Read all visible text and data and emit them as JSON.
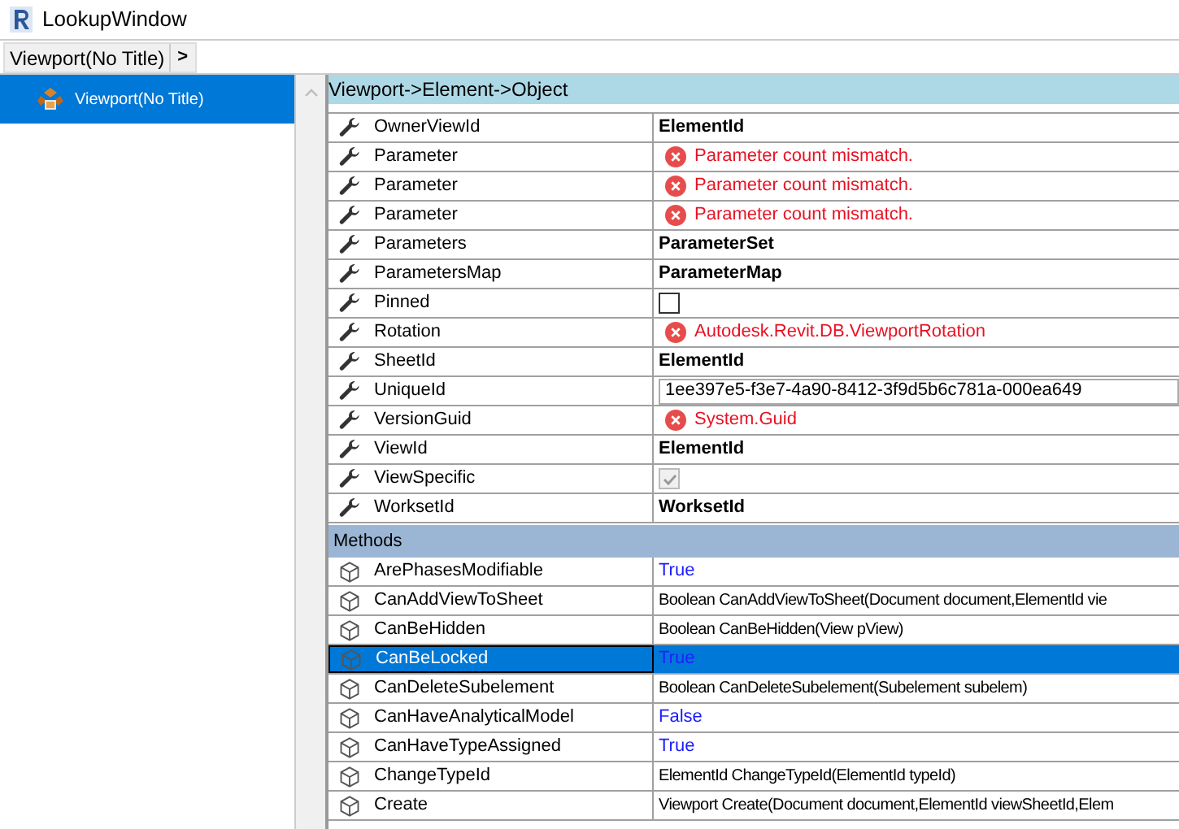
{
  "window": {
    "title": "LookupWindow"
  },
  "breadcrumb": {
    "items": [
      "Viewport(No Title)"
    ],
    "separator": ">"
  },
  "tree": {
    "items": [
      {
        "label": "Viewport(No Title)",
        "selected": true
      }
    ]
  },
  "inspector": {
    "header": "Viewport->Element->Object",
    "properties": [
      {
        "name": "OwnerViewId",
        "kind": "type",
        "value": "ElementId"
      },
      {
        "name": "Parameter",
        "kind": "error",
        "value": "Parameter count mismatch."
      },
      {
        "name": "Parameter",
        "kind": "error",
        "value": "Parameter count mismatch."
      },
      {
        "name": "Parameter",
        "kind": "error",
        "value": "Parameter count mismatch."
      },
      {
        "name": "Parameters",
        "kind": "type",
        "value": "ParameterSet"
      },
      {
        "name": "ParametersMap",
        "kind": "type",
        "value": "ParameterMap"
      },
      {
        "name": "Pinned",
        "kind": "checkbox",
        "checked": false,
        "disabled": false
      },
      {
        "name": "Rotation",
        "kind": "error",
        "value": "Autodesk.Revit.DB.ViewportRotation"
      },
      {
        "name": "SheetId",
        "kind": "type",
        "value": "ElementId"
      },
      {
        "name": "UniqueId",
        "kind": "field",
        "value": "1ee397e5-f3e7-4a90-8412-3f9d5b6c781a-000ea649"
      },
      {
        "name": "VersionGuid",
        "kind": "error",
        "value": "System.Guid"
      },
      {
        "name": "ViewId",
        "kind": "type",
        "value": "ElementId"
      },
      {
        "name": "ViewSpecific",
        "kind": "checkbox",
        "checked": true,
        "disabled": true
      },
      {
        "name": "WorksetId",
        "kind": "type",
        "value": "WorksetId"
      }
    ],
    "methods_header": "Methods",
    "methods": [
      {
        "name": "ArePhasesModifiable",
        "kind": "bool",
        "value": "True",
        "selected": false
      },
      {
        "name": "CanAddViewToSheet",
        "kind": "signature",
        "value": "Boolean CanAddViewToSheet(Document document,ElementId vie",
        "selected": false
      },
      {
        "name": "CanBeHidden",
        "kind": "signature",
        "value": "Boolean CanBeHidden(View pView)",
        "selected": false
      },
      {
        "name": "CanBeLocked",
        "kind": "bool",
        "value": "True",
        "selected": true
      },
      {
        "name": "CanDeleteSubelement",
        "kind": "signature",
        "value": "Boolean CanDeleteSubelement(Subelement subelem)",
        "selected": false
      },
      {
        "name": "CanHaveAnalyticalModel",
        "kind": "bool",
        "value": "False",
        "selected": false
      },
      {
        "name": "CanHaveTypeAssigned",
        "kind": "bool",
        "value": "True",
        "selected": false
      },
      {
        "name": "ChangeTypeId",
        "kind": "signature",
        "value": "ElementId ChangeTypeId(ElementId typeId)",
        "selected": false
      },
      {
        "name": "Create",
        "kind": "signature",
        "value": "Viewport Create(Document document,ElementId viewSheetId,Elem",
        "selected": false
      }
    ]
  }
}
